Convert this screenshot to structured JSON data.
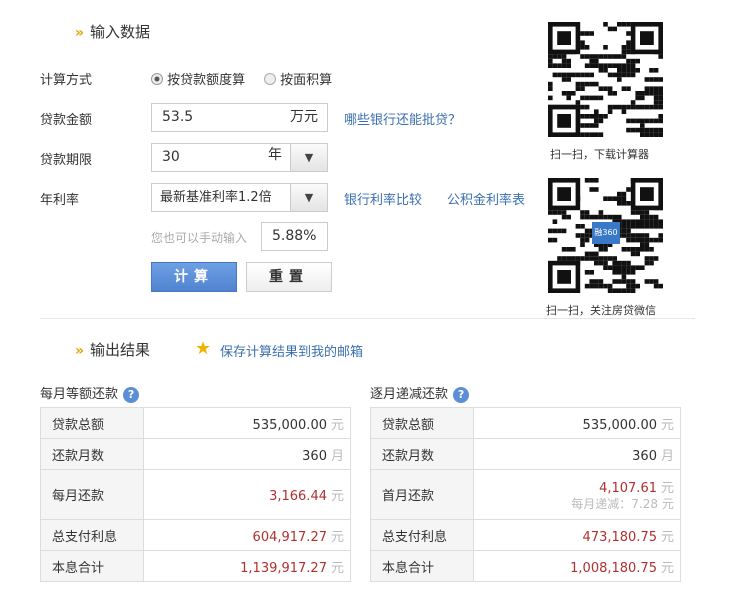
{
  "input": {
    "title": "输入数据",
    "method_label": "计算方式",
    "method_options": [
      "按贷款额度算",
      "按面积算"
    ],
    "amount_label": "贷款金额",
    "amount_value": "53.5",
    "amount_unit": "万元",
    "amount_link": "哪些银行还能批贷？",
    "term_label": "贷款期限",
    "term_value": "30",
    "term_unit": "年",
    "rate_label": "年利率",
    "rate_value": "最新基准利率1.2倍",
    "rate_link1": "银行利率比较",
    "rate_link2": "公积金利率表",
    "manual_hint": "您也可以手动输入",
    "manual_value": "5.88%",
    "calc_label": "计算",
    "reset_label": "重置"
  },
  "qr": {
    "caption1": "扫一扫，下载计算器",
    "caption2": "扫一扫，关注房贷微信",
    "logo": "融360"
  },
  "output": {
    "title": "输出结果",
    "save_link": "保存计算结果到我的邮箱",
    "left": {
      "title": "每月等额还款",
      "rows": [
        [
          "贷款总额",
          "535,000.00",
          "元"
        ],
        [
          "还款月数",
          "360",
          "月"
        ],
        [
          "每月还款",
          "3,166.44",
          "元"
        ],
        [
          "总支付利息",
          "604,917.27",
          "元"
        ],
        [
          "本息合计",
          "1,139,917.27",
          "元"
        ]
      ]
    },
    "right": {
      "title": "逐月递减还款",
      "rows": [
        [
          "贷款总额",
          "535,000.00",
          "元"
        ],
        [
          "还款月数",
          "360",
          "月"
        ],
        [
          "首月还款",
          "4,107.61",
          "元"
        ],
        [
          "总支付利息",
          "473,180.75",
          "元"
        ],
        [
          "本息合计",
          "1,008,180.75",
          "元"
        ]
      ],
      "decrease_label": "每月递减：7.28",
      "decrease_unit": "元"
    }
  },
  "colors": {
    "accent": "#3b6fb0",
    "red": "#b03030",
    "button_blue": "#5b8ed6"
  }
}
